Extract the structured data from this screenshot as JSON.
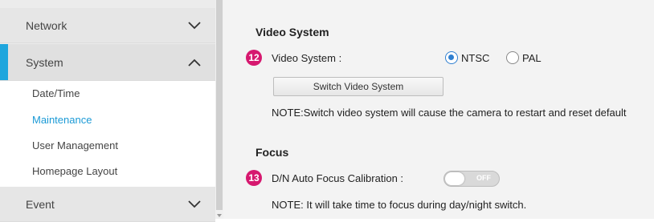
{
  "sidebar": {
    "sections": [
      {
        "label": "Network",
        "icon": "chevron-down-icon"
      },
      {
        "label": "System",
        "icon": "chevron-up-icon"
      },
      {
        "label": "Event",
        "icon": "chevron-down-icon"
      }
    ],
    "system_items": [
      {
        "label": "Date/Time"
      },
      {
        "label": "Maintenance"
      },
      {
        "label": "User Management"
      },
      {
        "label": "Homepage Layout"
      }
    ],
    "accent_color": "#1fa6dd"
  },
  "video_system": {
    "title": "Video System",
    "badge": "12",
    "field_label": "Video System :",
    "options": [
      {
        "label": "NTSC",
        "checked": true
      },
      {
        "label": "PAL",
        "checked": false
      }
    ],
    "switch_button": "Switch Video System",
    "note": "NOTE:Switch video system will cause the camera to restart and reset default"
  },
  "focus": {
    "title": "Focus",
    "badge": "13",
    "field_label": "D/N Auto Focus Calibration :",
    "toggle_state": "OFF",
    "note": "NOTE: It will take time to focus during day/night switch."
  },
  "colors": {
    "badge": "#d6186f",
    "selected_item": "#1b9ad6"
  }
}
